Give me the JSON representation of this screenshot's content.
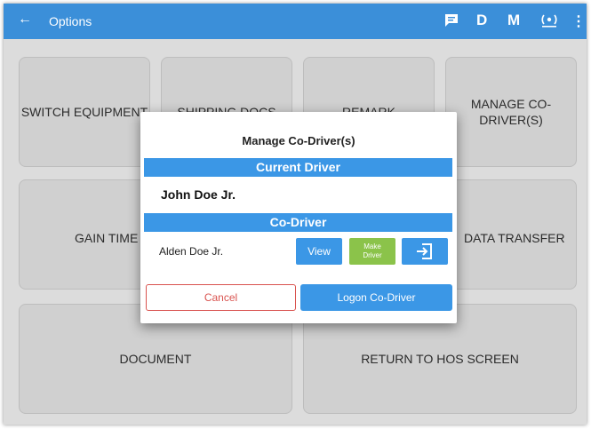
{
  "appbar": {
    "back_icon": "arrow-left-icon",
    "title": "Options",
    "actions": [
      {
        "name": "message-icon",
        "label": "▤"
      },
      {
        "name": "d-button",
        "label": "D"
      },
      {
        "name": "m-button",
        "label": "M"
      },
      {
        "name": "eld-signal-icon",
        "label": "(·)"
      },
      {
        "name": "more-icon",
        "label": "⋮"
      }
    ]
  },
  "tiles": {
    "switch_equipment": "SWITCH EQUIPMENT",
    "shipping_docs": "SHIPPING DOCS",
    "remark": "REMARK",
    "manage_co_driver": "MANAGE CO-DRIVER(S)",
    "gain_time": "GAIN TIME",
    "data_transfer": "DATA TRANSFER",
    "document": "DOCUMENT",
    "return_hos": "RETURN TO HOS SCREEN"
  },
  "dialog": {
    "title": "Manage Co-Driver(s)",
    "current_driver_header": "Current Driver",
    "current_driver_name": "John Doe Jr.",
    "co_driver_header": "Co-Driver",
    "co_driver_name": "Alden Doe Jr.",
    "view_label": "View",
    "make_driver_line1": "Make",
    "make_driver_line2": "Driver",
    "logout_icon": "logout-icon",
    "cancel_label": "Cancel",
    "logon_label": "Logon Co-Driver"
  },
  "colors": {
    "appbar": "#3b8fd9",
    "accent_blue": "#3b97e6",
    "make_driver_green": "#8bc34a",
    "cancel_red": "#d9534f",
    "background": "#dcdcdc"
  }
}
